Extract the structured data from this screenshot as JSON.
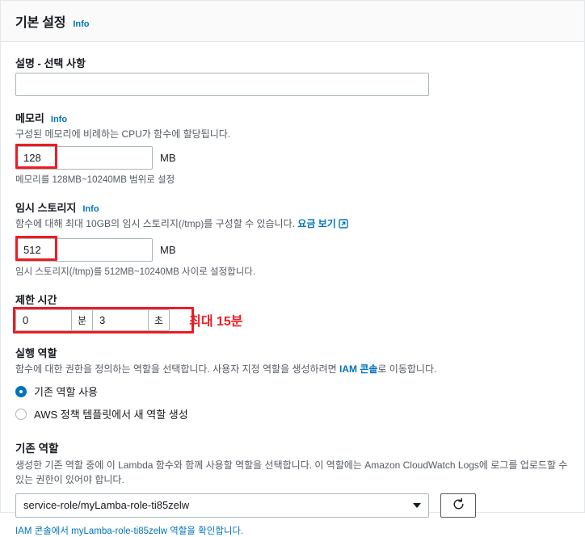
{
  "header": {
    "title": "기본 설정",
    "info_label": "Info"
  },
  "description_field": {
    "label": "설명 - 선택 사항",
    "value": "",
    "placeholder": ""
  },
  "memory": {
    "label": "메모리",
    "info_label": "Info",
    "description": "구성된 메모리에 비례하는 CPU가 함수에 할당됩니다.",
    "value": "128",
    "unit": "MB",
    "hint": "메모리를 128MB~10240MB 범위로 설정"
  },
  "ephemeral_storage": {
    "label": "임시 스토리지",
    "info_label": "Info",
    "description_before_link": "함수에 대해 최대 10GB의 임시 스토리지(/tmp)를 구성할 수 있습니다. ",
    "pricing_link": "요금 보기",
    "value": "512",
    "unit": "MB",
    "hint": "임시 스토리지(/tmp)를 512MB~10240MB 사이로 설정합니다."
  },
  "timeout": {
    "label": "제한 시간",
    "minutes_value": "0",
    "minutes_unit": "분",
    "seconds_value": "3",
    "seconds_unit": "초",
    "annotation": "최대 15분"
  },
  "execution_role": {
    "label": "실행 역할",
    "description_before_link": "함수에 대한 권한을 정의하는 역할을 선택합니다. 사용자 지정 역할을 생성하려면 ",
    "iam_link": "IAM 콘솔",
    "description_after_link": "로 이동합니다.",
    "options": [
      {
        "label": "기존 역할 사용",
        "selected": true
      },
      {
        "label": "AWS 정책 템플릿에서 새 역할 생성",
        "selected": false
      }
    ]
  },
  "existing_role": {
    "label": "기존 역할",
    "description": "생성한 기존 역할 중에 이 Lambda 함수와 함께 사용할 역할을 선택합니다. 이 역할에는 Amazon CloudWatch Logs에 로그를 업로드할 수 있는 권한이 있어야 합니다.",
    "selected_value": "service-role/myLamba-role-ti85zelw",
    "refresh_icon": "refresh-icon",
    "footer_link_prefix": "IAM 콘솔에서 ",
    "footer_link_role": "myLamba-role-ti85zelw",
    "footer_link_suffix": " 역할을 확인합니다."
  },
  "colors": {
    "accent_blue": "#0073bb",
    "annotation_red": "#ed1c24",
    "border_gray": "#aab7b8",
    "text_muted": "#545b64"
  }
}
